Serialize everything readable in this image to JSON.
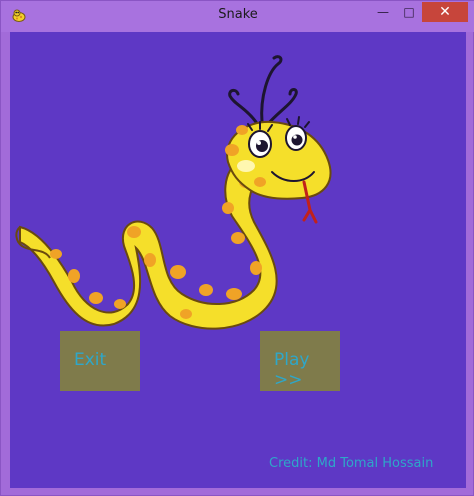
{
  "window": {
    "title": "Snake",
    "minimize_glyph": "—",
    "maximize_glyph": "□",
    "close_glyph": "✕",
    "app_icon": "snake-app-icon"
  },
  "game": {
    "background_color": "#5e38c5",
    "illustration": "cartoon-yellow-snake",
    "buttons": {
      "exit_label": "Exit",
      "play_label": "Play >>"
    },
    "credit": "Credit: Md Tomal Hossain"
  },
  "colors": {
    "button_bg": "#7f7b4b",
    "button_text": "#2ea7c9",
    "close_button": "#c7453b",
    "frame": "#a26bd9",
    "snake_yellow": "#f5df2a",
    "snake_spots": "#f0a326"
  }
}
